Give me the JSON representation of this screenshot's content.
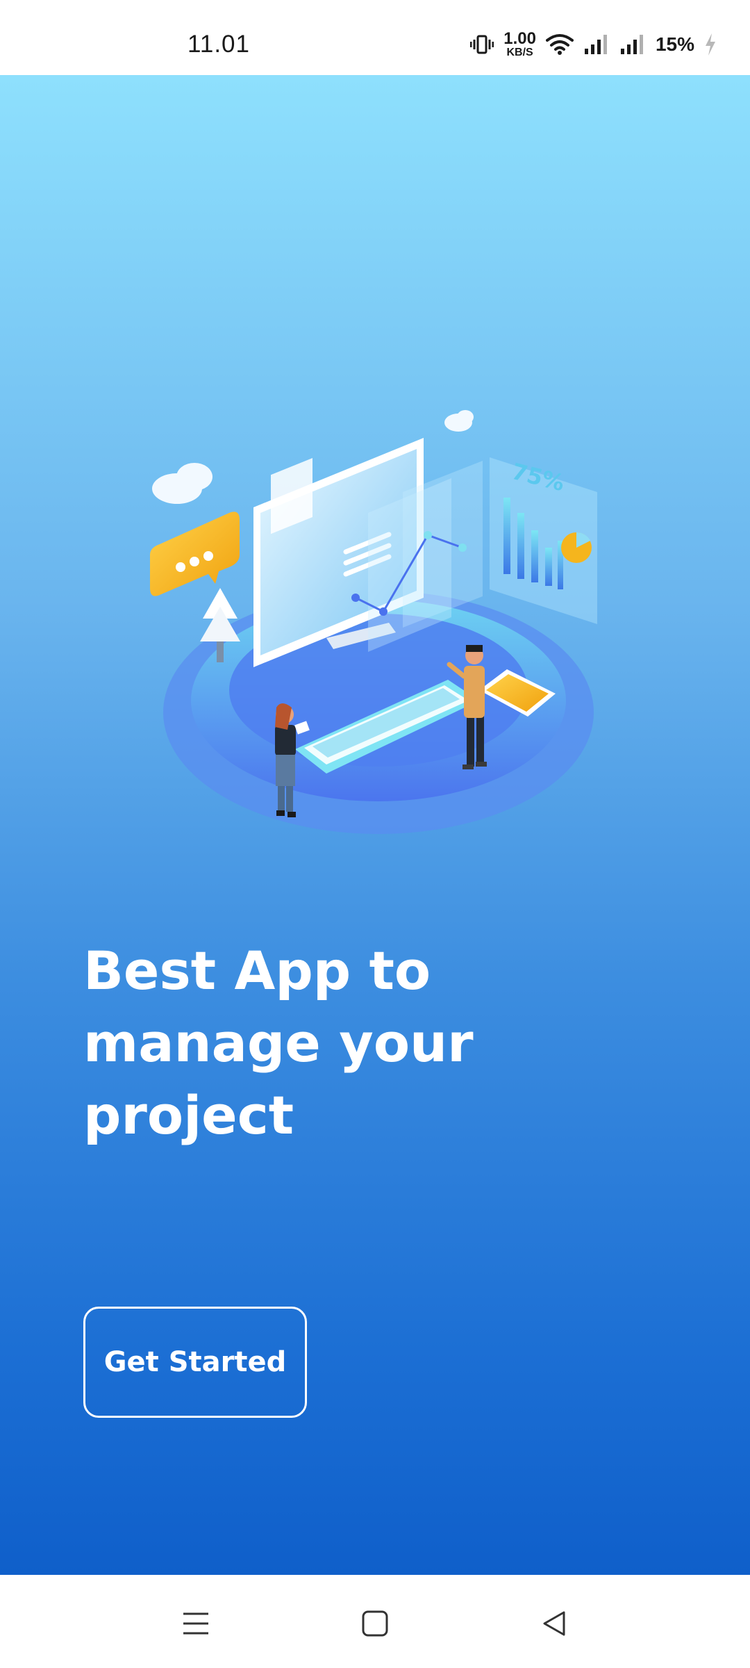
{
  "status_bar": {
    "time": "11.01",
    "net_speed_value": "1.00",
    "net_speed_unit": "KB/S",
    "battery": "15%",
    "icons": [
      "vibrate-icon",
      "wifi-icon",
      "signal-icon",
      "signal-icon",
      "charging-icon"
    ]
  },
  "hero": {
    "percent_label": "75%",
    "colors": {
      "yellow": "#f5b51d",
      "blue": "#4a7ff0",
      "teal": "#6fe4f0"
    }
  },
  "headline": {
    "line1": "Best App to",
    "line2": "manage your",
    "line3": "project"
  },
  "cta": {
    "label": "Get Started"
  },
  "nav_bar": {
    "icons": [
      "menu-icon",
      "home-icon",
      "back-icon"
    ]
  }
}
